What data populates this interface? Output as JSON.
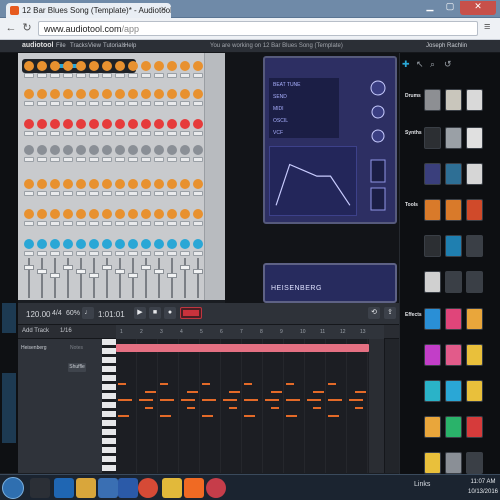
{
  "browser": {
    "tab_title": "12 Bar Blues Song (Template)* - Audiotool - Google Chrome",
    "url_host": "www.audiotool.com",
    "url_path": "/app"
  },
  "app": {
    "logo": "audiotool",
    "menu": [
      "File",
      "Tracks",
      "View",
      "Tutorials",
      "Help"
    ],
    "status": "You are working on 12 Bar Blues Song (Template)",
    "user": "Joseph Rachlin"
  },
  "synth": {
    "rows": [
      "BEAT TUNE",
      "SEND",
      "MIDI",
      "OSCIL",
      "VCF"
    ],
    "name": "HEISENBERG"
  },
  "device_browser": {
    "categories": [
      "Drums",
      "Synths",
      "Tools",
      "Effects"
    ]
  },
  "sequencer": {
    "tempo": "120.00",
    "signature": "4/4",
    "swing": "60%",
    "position": "1:01:01",
    "add_track": "Add Track",
    "zoom": "1/16",
    "track_name": "Heisenberg",
    "track_mode": "Notes",
    "shuffle": "Shuffle",
    "ruler_ticks": [
      "1",
      "2",
      "3",
      "4",
      "5",
      "6",
      "7",
      "8",
      "9",
      "10",
      "11",
      "12",
      "13"
    ]
  },
  "taskbar": {
    "tray_label": "Links",
    "time": "11:07 AM",
    "date": "10/13/2016"
  },
  "colors": {
    "accent_blue": "#2aa7d6",
    "note_orange": "#e36a28",
    "clip_pink": "#e47082",
    "record_red": "#c9323c"
  }
}
